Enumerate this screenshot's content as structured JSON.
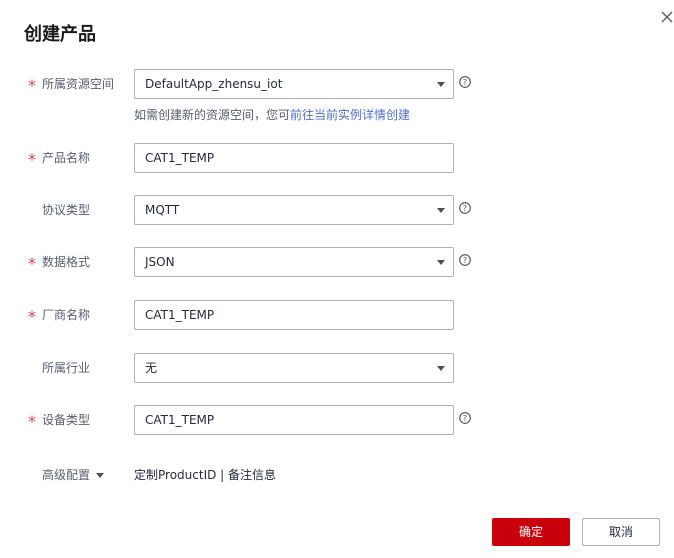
{
  "dialog": {
    "title": "创建产品",
    "close_icon": "close-icon"
  },
  "form": {
    "required_mark": "*",
    "resource_space": {
      "label": "所属资源空间",
      "value": "DefaultApp_zhensu_iot",
      "hint_prefix": "如需创建新的资源空间，您可",
      "hint_link": "前往当前实例详情创建"
    },
    "product_name": {
      "label": "产品名称",
      "value": "CAT1_TEMP"
    },
    "protocol": {
      "label": "协议类型",
      "value": "MQTT"
    },
    "data_format": {
      "label": "数据格式",
      "value": "JSON"
    },
    "vendor": {
      "label": "厂商名称",
      "value": "CAT1_TEMP"
    },
    "industry": {
      "label": "所属行业",
      "value": "无"
    },
    "device_type": {
      "label": "设备类型",
      "value": "CAT1_TEMP"
    },
    "advanced": {
      "label": "高级配置",
      "summary": "定制ProductID | 备注信息"
    }
  },
  "buttons": {
    "ok": "确定",
    "cancel": "取消"
  },
  "colors": {
    "primary": "#c7000b",
    "required": "#e6404b",
    "link": "#526ecc",
    "border": "#adb0b8"
  }
}
